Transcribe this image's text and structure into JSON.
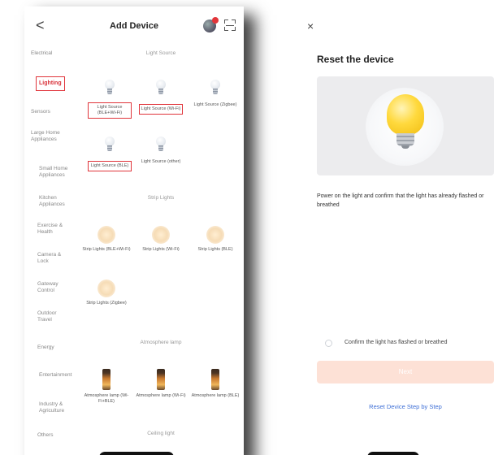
{
  "left": {
    "title": "Add Device",
    "back_glyph": "<",
    "categories": [
      "Electrical",
      "Lighting",
      "Sensors",
      "Large Home Appliances",
      "Small Home Appliances",
      "Kitchen Appliances",
      "Exercise & Health",
      "Camera & Lock",
      "Gateway Control",
      "Outdoor Travel",
      "Energy",
      "Entertainment",
      "Industry & Agriculture",
      "Others"
    ],
    "sections": {
      "light_source": "Light Source",
      "strip_lights": "Strip Lights",
      "atmosphere_lamp": "Atmosphere lamp",
      "ceiling_light": "Ceiling light"
    },
    "devices": {
      "ls_ble_wifi": "Light Source (BLE+Wi-Fi)",
      "ls_wifi": "Light Source (Wi-Fi)",
      "ls_zigbee": "Light Source (Zigbee)",
      "ls_ble": "Light Source (BLE)",
      "ls_other": "Light Source (other)",
      "sl_ble_wifi": "Strip Lights (BLE+Wi-Fi)",
      "sl_wifi": "Strip Lights (Wi-Fi)",
      "sl_ble": "Strip Lights (BLE)",
      "sl_zigbee": "Strip Lights (Zigbee)",
      "al_wifi_ble": "Atmosphere lamp (Wi-Fi+BLE)",
      "al_wifi": "Atmosphere lamp (Wi-Fi)",
      "al_ble": "Atmosphere lamp (BLE)"
    }
  },
  "right": {
    "close_glyph": "×",
    "title": "Reset the device",
    "instruction": "Power on the light and confirm that the light has already flashed or breathed",
    "confirm_label": "Confirm the light has flashed or breathed",
    "next_label": "Next",
    "link_label": "Reset Device Step by Step"
  },
  "colors": {
    "highlight": "#e0353b",
    "link": "#3e6fd6",
    "next_disabled": "#fde1d6"
  }
}
